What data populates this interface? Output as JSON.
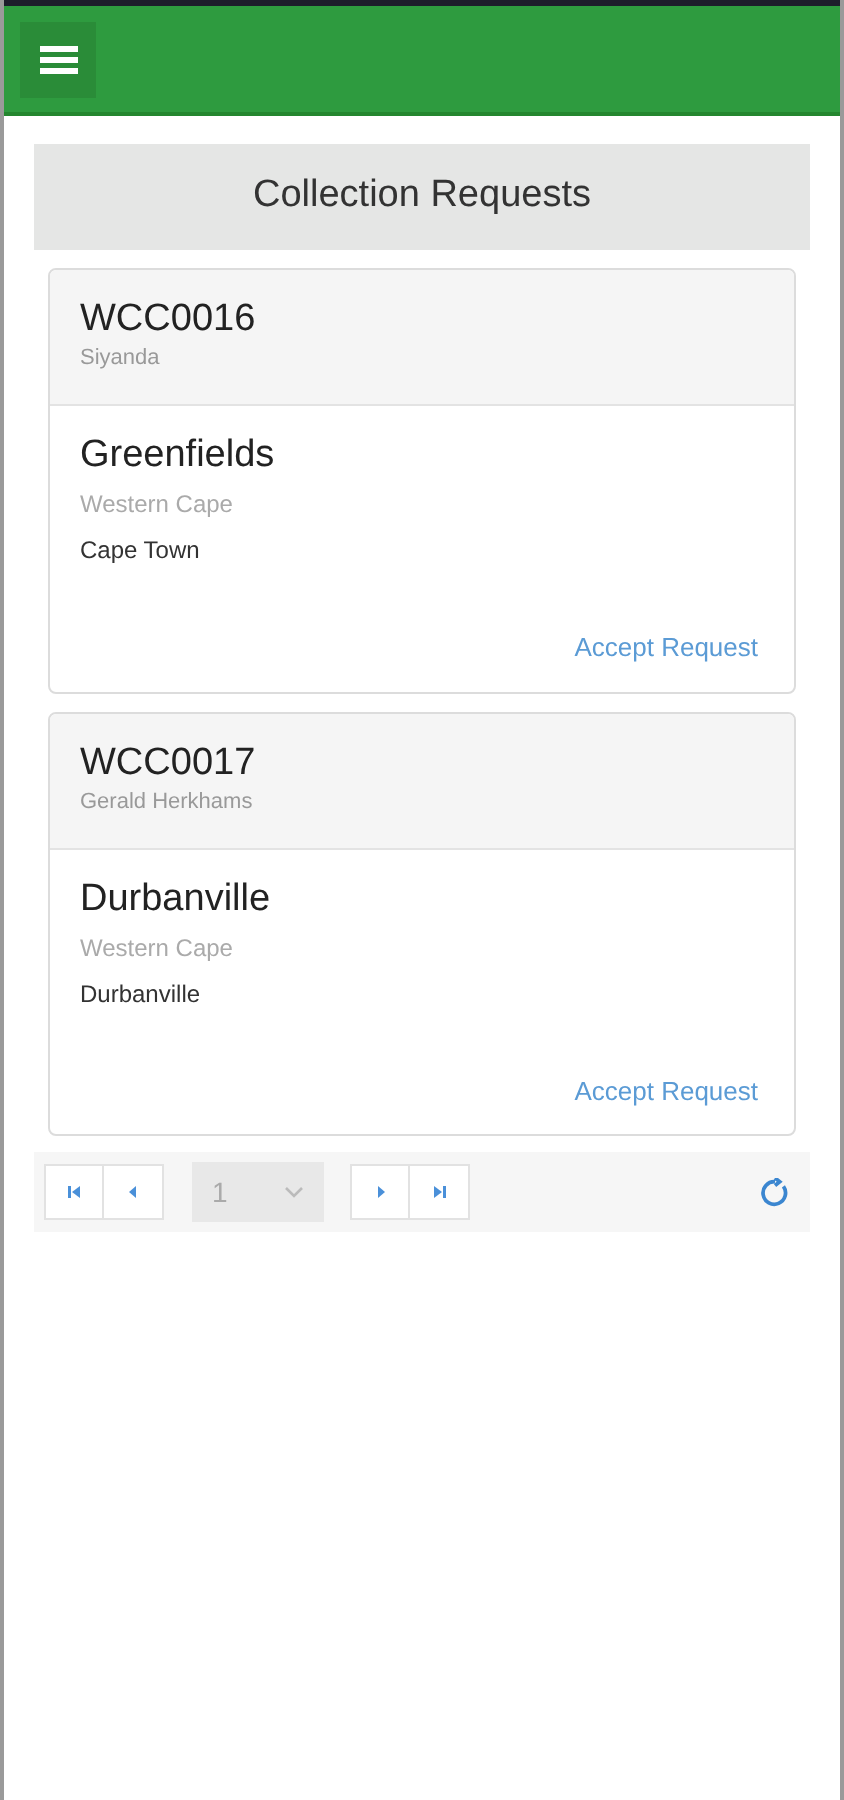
{
  "title": "Collection Requests",
  "requests": [
    {
      "code": "WCC0016",
      "name": "Siyanda",
      "area": "Greenfields",
      "province": "Western Cape",
      "city": "Cape Town",
      "action": "Accept Request"
    },
    {
      "code": "WCC0017",
      "name": "Gerald Herkhams",
      "area": "Durbanville",
      "province": "Western Cape",
      "city": "Durbanville",
      "action": "Accept Request"
    }
  ],
  "pager": {
    "page": "1",
    "disabled": true
  }
}
